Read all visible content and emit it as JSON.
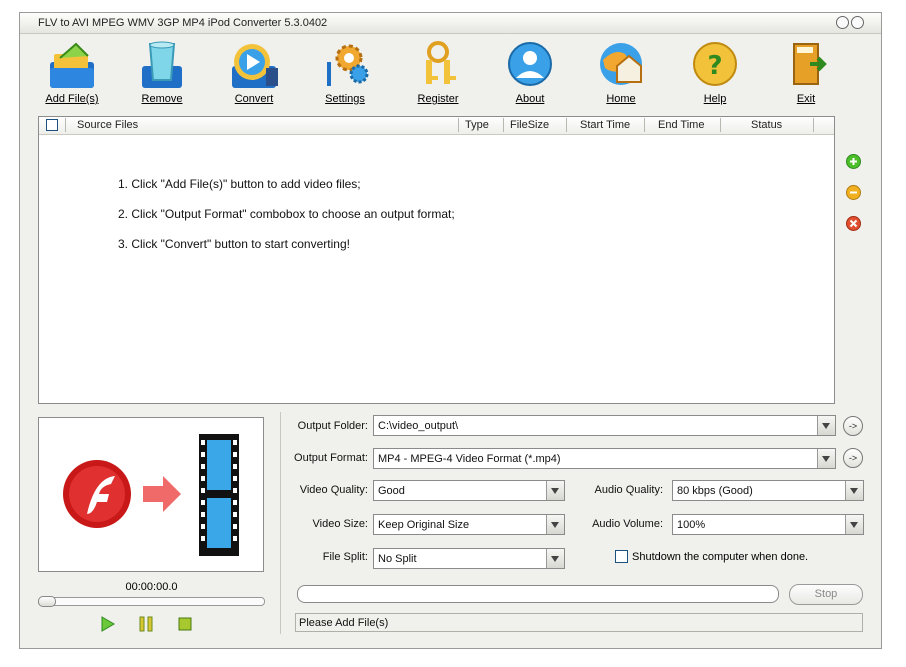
{
  "window": {
    "title": "FLV to AVI MPEG WMV 3GP MP4 iPod Converter 5.3.0402"
  },
  "toolbar": {
    "add": "Add File(s)",
    "remove": "Remove",
    "convert": "Convert",
    "settings": "Settings",
    "register": "Register",
    "about": "About",
    "home": "Home",
    "help": "Help",
    "exit": "Exit"
  },
  "file_list": {
    "columns": [
      "Source Files",
      "Type",
      "FileSize",
      "Start Time",
      "End Time",
      "Status"
    ],
    "instructions": [
      "1. Click \"Add File(s)\" button to add video files;",
      "2. Click \"Output Format\" combobox to choose an output format;",
      "3. Click \"Convert\" button to start converting!"
    ]
  },
  "player": {
    "time": "00:00:00.0"
  },
  "settings": {
    "output_folder_label": "Output Folder:",
    "output_folder": "C:\\video_output\\",
    "output_format_label": "Output Format:",
    "output_format": "MP4 - MPEG-4 Video Format (*.mp4)",
    "video_quality_label": "Video Quality:",
    "video_quality": "Good",
    "audio_quality_label": "Audio Quality:",
    "audio_quality": "80  kbps (Good)",
    "video_size_label": "Video Size:",
    "video_size": "Keep Original Size",
    "audio_volume_label": "Audio Volume:",
    "audio_volume": "100%",
    "file_split_label": "File Split:",
    "file_split": "No Split",
    "shutdown_label": "Shutdown the computer when done.",
    "browse_label": "->"
  },
  "actions": {
    "stop": "Stop",
    "progress": 0
  },
  "status": {
    "text": "Please Add File(s)"
  }
}
